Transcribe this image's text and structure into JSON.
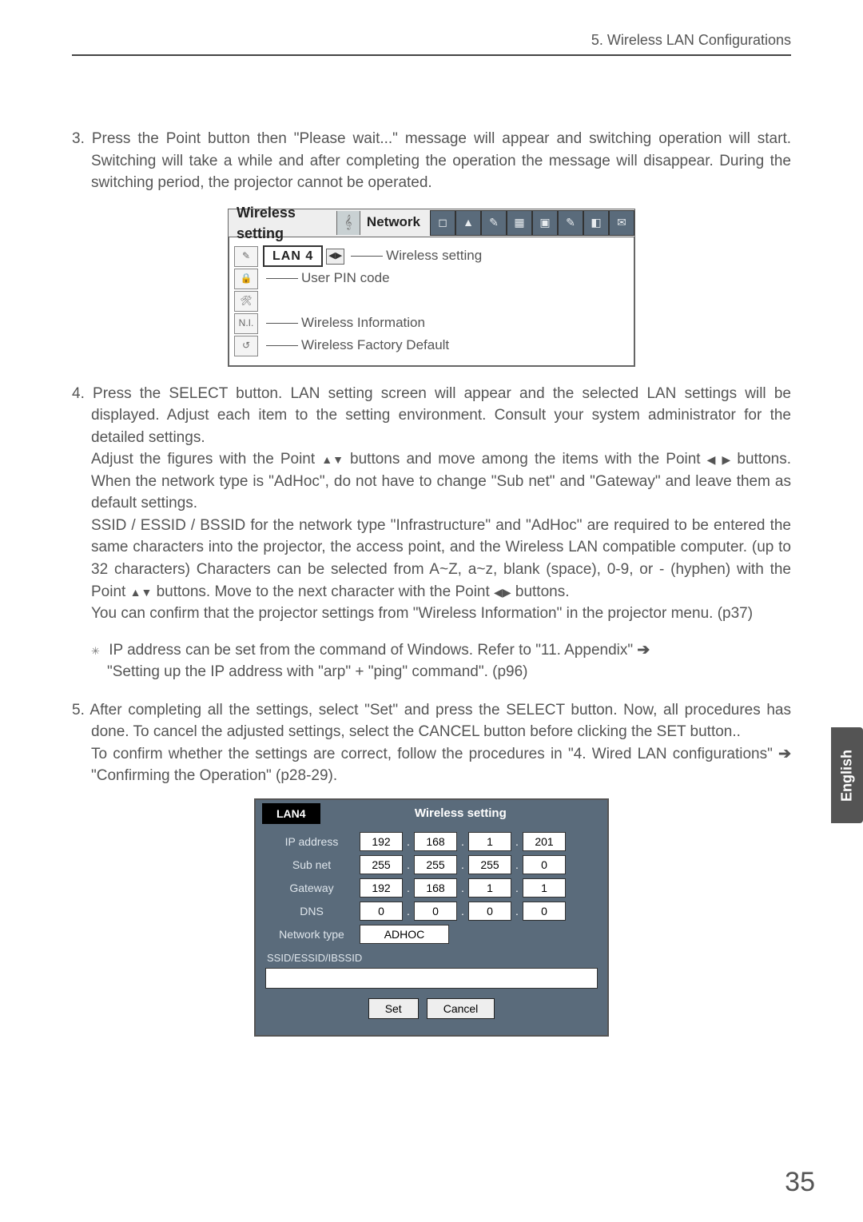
{
  "header": {
    "section_title": "5. Wireless LAN Configurations"
  },
  "step3": {
    "text": "3. Press the Point button then \"Please wait...\" message will appear and switching operation will start.  Switching will take a while and after completing the operation the message will disappear.  During the switching period, the projector cannot be operated."
  },
  "menu": {
    "top_label": "Wireless setting",
    "network_label": "Network",
    "lan_label": "LAN 4",
    "item_wireless_setting": "Wireless setting",
    "item_user_pin": "User PIN code",
    "item_wireless_info": "Wireless Information",
    "item_factory_default": "Wireless Factory Default",
    "side_icons": {
      "ni": "N.I."
    }
  },
  "step4": {
    "p1": "4. Press the SELECT button.  LAN setting screen will appear and the selected LAN settings will be displayed.  Adjust each item to the setting environment.  Consult your system administrator for the detailed settings.",
    "p2a": "Adjust the figures with the Point ",
    "p2b": " buttons and move among the items with the Point ",
    "p2c": " buttons.  When the network type is \"AdHoc\", do not have to change \"Sub net\" and \"Gateway\" and leave them as default settings.",
    "p3": "SSID / ESSID / BSSID for the network type \"Infrastructure\" and \"AdHoc\" are required to be entered the same characters into the projector, the access point, and the Wireless LAN compatible computer.  (up to 32 characters)  Characters can be selected from A~Z, a~z, blank (space), 0-9, or - (hyphen) with the Point ",
    "p3b": " buttons.  Move to the next character with the Point ",
    "p3c": " buttons.",
    "p4": "You can confirm that the projector settings from \"Wireless Information\" in the projector menu.  (p37)",
    "note1": "IP address can be set from the command of Windows.  Refer to \"11. Appendix\" ",
    "note2": "\"Setting up the IP address with \"arp\" + \"ping\" command\".  (p96)"
  },
  "step5": {
    "p1": "5. After completing all the settings, select \"Set\" and press the SELECT button.  Now, all procedures has done.  To cancel the adjusted settings, select the CANCEL button before clicking the SET button..",
    "p2a": "To confirm whether the settings are correct, follow the procedures in \"4. Wired LAN configurations\"  ",
    "p2b": " \"Confirming the Operation\" (p28-29)."
  },
  "settings_dialog": {
    "lan_label": "LAN4",
    "title": "Wireless setting",
    "rows": {
      "ip": {
        "label": "IP address",
        "v": [
          "192",
          "168",
          "1",
          "201"
        ]
      },
      "sub": {
        "label": "Sub net",
        "v": [
          "255",
          "255",
          "255",
          "0"
        ]
      },
      "gw": {
        "label": "Gateway",
        "v": [
          "192",
          "168",
          "1",
          "1"
        ]
      },
      "dns": {
        "label": "DNS",
        "v": [
          "0",
          "0",
          "0",
          "0"
        ]
      },
      "nt": {
        "label": "Network type",
        "value": "ADHOC"
      },
      "ssid": {
        "label": "SSID/ESSID/IBSSID"
      }
    },
    "buttons": {
      "set": "Set",
      "cancel": "Cancel"
    }
  },
  "side_tab": "English",
  "page_number": "35"
}
